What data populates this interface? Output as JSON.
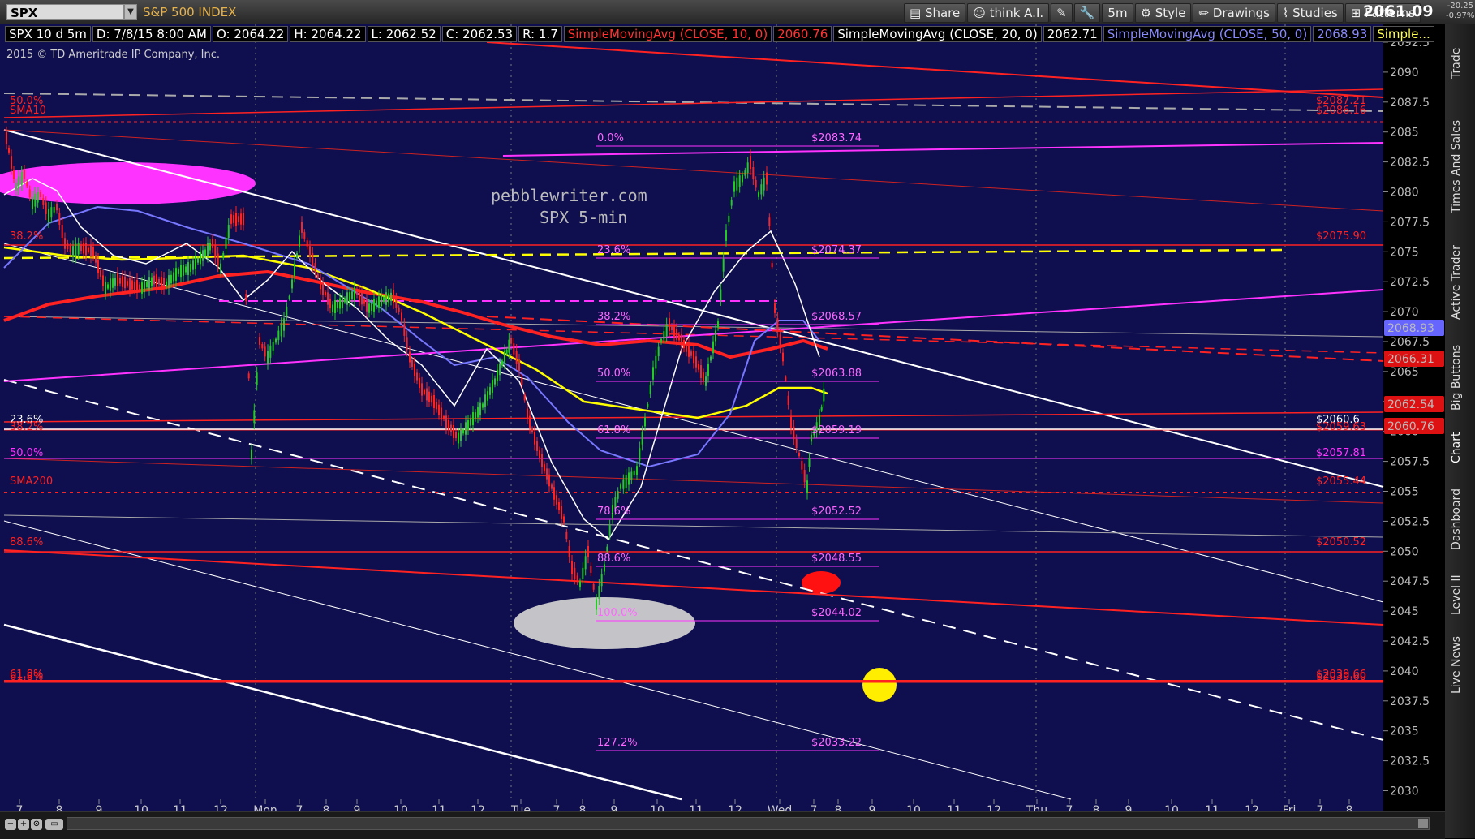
{
  "header": {
    "symbol": "SPX",
    "name": "S&P 500 INDEX",
    "toolbar": [
      "Share",
      "think A.I.",
      "5m",
      "Style",
      "Drawings",
      "Studies",
      "Patterns"
    ],
    "last": "2061.09",
    "change": "-20.25",
    "change_pct": "-0.97%"
  },
  "infobar": {
    "period": "SPX 10 d 5m",
    "date": "D: 7/8/15 8:00 AM",
    "open": "O: 2064.22",
    "high": "H: 2064.22",
    "low": "L: 2062.52",
    "close": "C: 2062.53",
    "range": "R: 1.7",
    "sma10": "SimpleMovingAvg (CLOSE, 10, 0)",
    "sma10_val": "2060.76",
    "sma20": "SimpleMovingAvg (CLOSE, 20, 0)",
    "sma20_val": "2062.71",
    "sma50": "SimpleMovingAvg (CLOSE, 50, 0)",
    "sma50_val": "2068.93",
    "more": "Simple..."
  },
  "copyright": "2015 © TD Ameritrade IP Company, Inc.",
  "annotation": {
    "line1": "pebblewriter.com",
    "line2": "SPX 5-min"
  },
  "right_tabs": [
    "Trade",
    "Times And Sales",
    "Active Trader",
    "Big Buttons",
    "Chart",
    "Dashboard",
    "Level II",
    "Live News"
  ],
  "colors": {
    "bg": "#0f0f4f",
    "red": "#ff2222",
    "magenta": "#ff33ff",
    "yellow": "#ffff00",
    "blue": "#7777ff",
    "white": "#ffffff",
    "grey": "#aaaaaa"
  },
  "chart_data": {
    "type": "candlestick",
    "y_ticks": [
      "2092.5",
      "2090",
      "2087.5",
      "2085",
      "2082.5",
      "2080",
      "2077.5",
      "2075",
      "2072.5",
      "2070",
      "2067.5",
      "2065",
      "2062.5",
      "2060",
      "2057.5",
      "2055",
      "2052.5",
      "2050",
      "2047.5",
      "2045",
      "2042.5",
      "2040",
      "2037.5",
      "2035",
      "2032.5",
      "2030"
    ],
    "x_ticks": [
      "7",
      "8",
      "9",
      "10",
      "11",
      "12",
      "Mon",
      "7",
      "8",
      "9",
      "10",
      "11",
      "12",
      "Tue",
      "7",
      "8",
      "9",
      "10",
      "11",
      "12",
      "Wed",
      "7",
      "8",
      "9",
      "10",
      "11",
      "12",
      "Thu",
      "7",
      "8",
      "9",
      "10",
      "11",
      "12",
      "Fri",
      "7",
      "8"
    ],
    "price_tags": [
      {
        "value": "2068.93",
        "color": "#7777ff"
      },
      {
        "value": "2066.31",
        "color": "#ff2222"
      },
      {
        "value": "2062.54",
        "color": "#ff2222"
      },
      {
        "value": "2060.76",
        "color": "#ff2222"
      }
    ],
    "fib_left": [
      {
        "label": "0.0%",
        "price": "$2083.74"
      },
      {
        "label": "23.6%",
        "price": "$2074.37"
      },
      {
        "label": "38.2%",
        "price": "$2068.57"
      },
      {
        "label": "50.0%",
        "price": "$2063.88"
      },
      {
        "label": "61.8%",
        "price": "$2059.19"
      },
      {
        "label": "78.6%",
        "price": "$2052.52"
      },
      {
        "label": "88.6%",
        "price": "$2048.55"
      },
      {
        "label": "100.0%",
        "price": "$2044.02"
      },
      {
        "label": "127.2%",
        "price": "$2033.22"
      }
    ],
    "level_labels": [
      {
        "text": "50.0%",
        "value": "2088.3",
        "color": "#ff2222"
      },
      {
        "text": "SMA10",
        "value": "2087.0",
        "color": "#ff2222"
      },
      {
        "text": "38.2%",
        "value": "2076.6",
        "color": "#ff2222"
      },
      {
        "text": "23.6%",
        "value": "2060.8",
        "color": "#ffffff"
      },
      {
        "text": "38.2%",
        "value": "2060.3",
        "color": "#ff2222"
      },
      {
        "text": "50.0%",
        "value": "2058.1",
        "color": "#ff33ff"
      },
      {
        "text": "SMA200",
        "value": "2055.7",
        "color": "#ff2222"
      },
      {
        "text": "88.6%",
        "value": "2051.0",
        "color": "#ff2222"
      },
      {
        "text": "61.8%",
        "value": "2040.0",
        "color": "#ff2222"
      },
      {
        "text": "61.8%",
        "value": "2039.7",
        "color": "#ff2222"
      }
    ],
    "right_labels": [
      {
        "text": "$2087.21",
        "value": "2088.2",
        "color": "#ff2222"
      },
      {
        "text": "$2086.16",
        "value": "2087.3",
        "color": "#ff2222"
      },
      {
        "text": "$2075.90",
        "value": "2075.9",
        "color": "#ff2222"
      },
      {
        "text": "$2060.6",
        "value": "2060.8",
        "color": "#ffffff"
      },
      {
        "text": "$2059.63",
        "value": "2060.1",
        "color": "#ff2222"
      },
      {
        "text": "$2057.81",
        "value": "2057.8",
        "color": "#ff33ff"
      },
      {
        "text": "$2055.44",
        "value": "2055.4",
        "color": "#ff2222"
      },
      {
        "text": "$2050.52",
        "value": "2050.5",
        "color": "#ff2222"
      },
      {
        "text": "$2039.66",
        "value": "2040.0",
        "color": "#ff2222"
      },
      {
        "text": "$2039.60",
        "value": "2039.7",
        "color": "#ff2222"
      }
    ]
  }
}
